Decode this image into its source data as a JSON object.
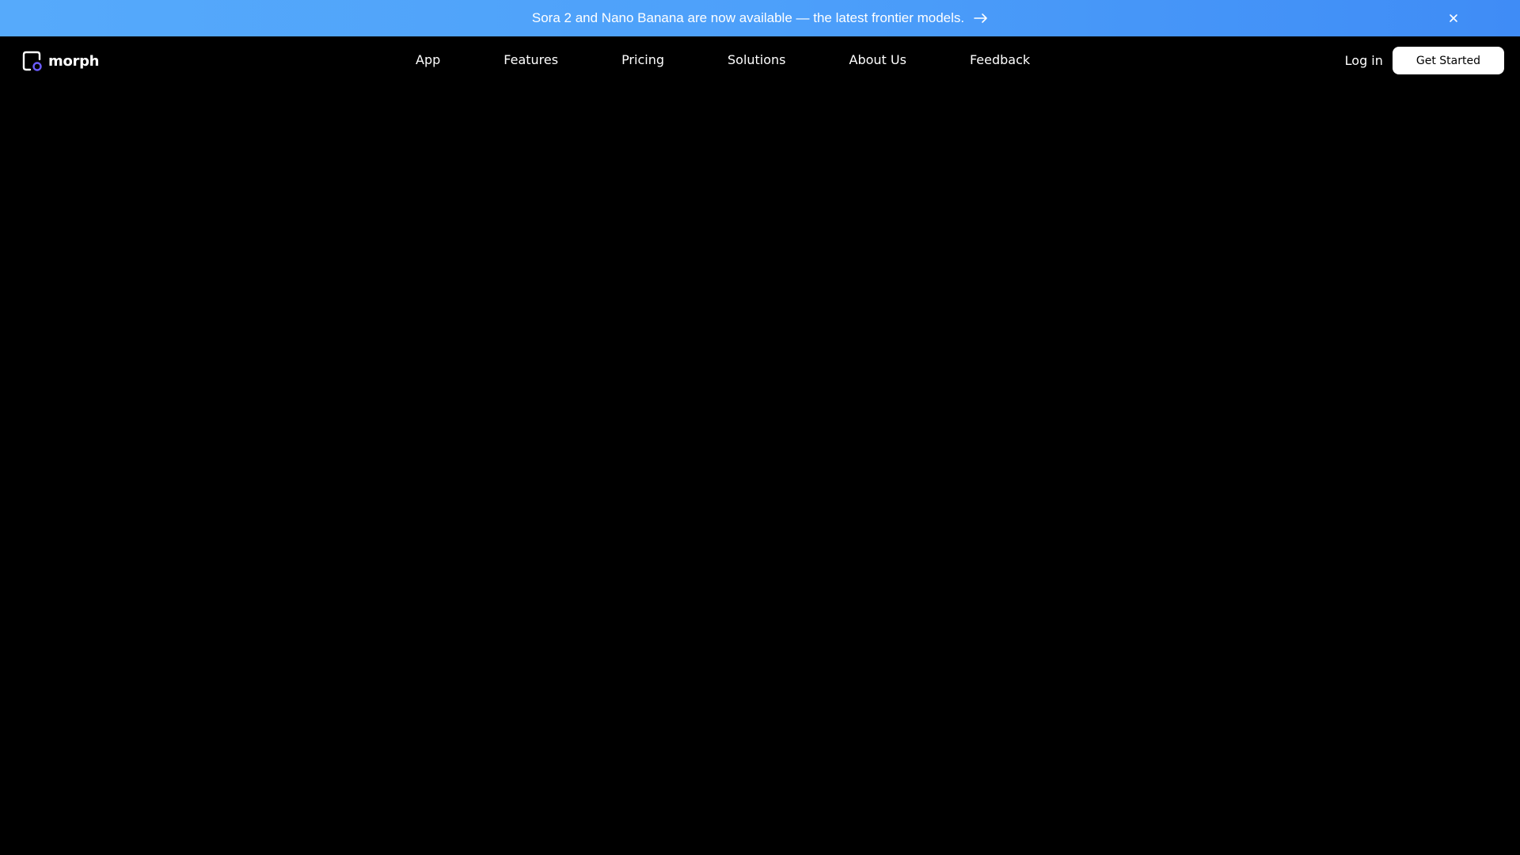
{
  "banner": {
    "message": "Sora 2 and Nano Banana are now available — the latest frontier models.",
    "arrow_icon": "arrow-right-icon",
    "close_icon": "close-icon",
    "colors": {
      "gradient_start": "#56aafb",
      "gradient_end": "#3f8cf6"
    }
  },
  "header": {
    "logo": {
      "text": "morph",
      "icon": "morph-logo-icon",
      "accent": "#6b5cff"
    },
    "nav": [
      {
        "label": "App"
      },
      {
        "label": "Features"
      },
      {
        "label": "Pricing"
      },
      {
        "label": "Solutions"
      },
      {
        "label": "About Us"
      },
      {
        "label": "Feedback"
      }
    ],
    "login_label": "Log in",
    "cta_label": "Get Started"
  },
  "page": {
    "background": "#000000"
  }
}
